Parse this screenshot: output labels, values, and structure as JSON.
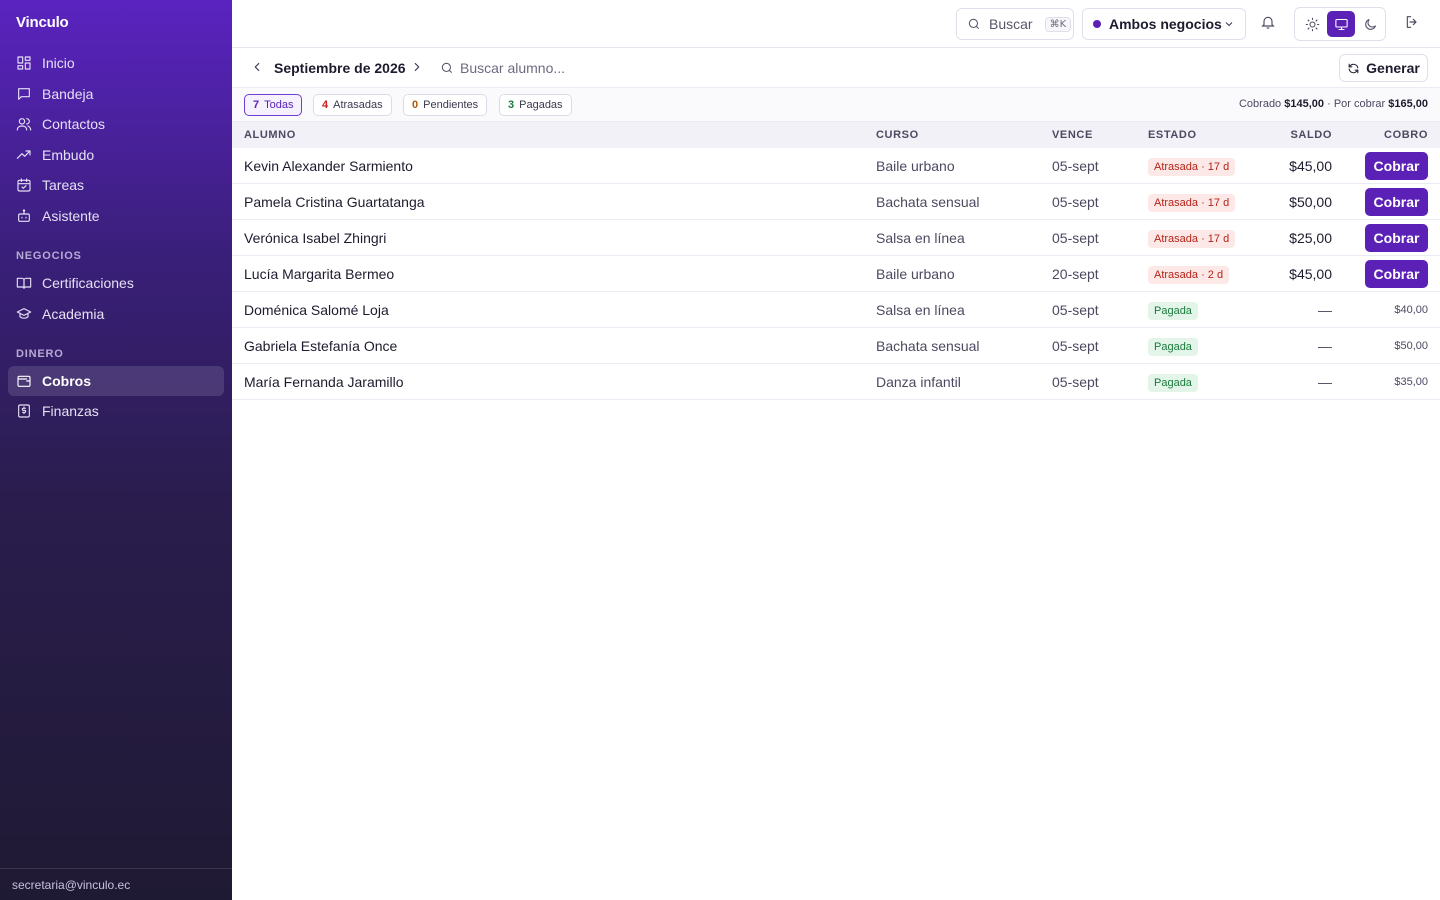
{
  "brand": "Vinculo",
  "sidebar": {
    "main": [
      {
        "label": "Inicio",
        "icon": "grid-icon"
      },
      {
        "label": "Bandeja",
        "icon": "message-icon"
      },
      {
        "label": "Contactos",
        "icon": "users-icon"
      },
      {
        "label": "Embudo",
        "icon": "trending-up-icon"
      },
      {
        "label": "Tareas",
        "icon": "calendar-check-icon"
      },
      {
        "label": "Asistente",
        "icon": "bot-icon"
      }
    ],
    "section_business": "NEGOCIOS",
    "business": [
      {
        "label": "Certificaciones",
        "icon": "book-icon"
      },
      {
        "label": "Academia",
        "icon": "graduation-cap-icon"
      }
    ],
    "section_money": "DINERO",
    "money": [
      {
        "label": "Cobros",
        "icon": "wallet-icon",
        "active": true
      },
      {
        "label": "Finanzas",
        "icon": "receipt-icon"
      }
    ],
    "footer_email": "secretaria@vinculo.ec"
  },
  "topbar": {
    "search_label": "Buscar",
    "search_shortcut": "⌘K",
    "business_select": "Ambos negocios",
    "theme_selected": "system"
  },
  "month": {
    "title": "Septiembre de 2026",
    "search_placeholder": "Buscar alumno...",
    "generate_label": "Generar"
  },
  "filters": [
    {
      "count": "7",
      "label": "Todas",
      "active": true,
      "color": "#5b21b6"
    },
    {
      "count": "4",
      "label": "Atrasadas",
      "color": "#c81e1e"
    },
    {
      "count": "0",
      "label": "Pendientes",
      "color": "#b45309"
    },
    {
      "count": "3",
      "label": "Pagadas",
      "color": "#1a7a3d"
    }
  ],
  "summary": {
    "collected_label": "Cobrado",
    "collected": "$145,00",
    "separator": "·",
    "pending_label": "Por cobrar",
    "pending": "$165,00"
  },
  "table": {
    "headers": [
      "ALUMNO",
      "CURSO",
      "VENCE",
      "ESTADO",
      "SALDO",
      "COBRO"
    ],
    "rows": [
      {
        "name": "Kevin Alexander Sarmiento",
        "course": "Baile urbano",
        "due": "05-sept",
        "status": "Atrasada · 17 d",
        "status_type": "late",
        "balance": "$45,00",
        "action": "Cobrar"
      },
      {
        "name": "Pamela Cristina Guartatanga",
        "course": "Bachata sensual",
        "due": "05-sept",
        "status": "Atrasada · 17 d",
        "status_type": "late",
        "balance": "$50,00",
        "action": "Cobrar"
      },
      {
        "name": "Verónica Isabel Zhingri",
        "course": "Salsa en línea",
        "due": "05-sept",
        "status": "Atrasada · 17 d",
        "status_type": "late",
        "balance": "$25,00",
        "action": "Cobrar"
      },
      {
        "name": "Lucía Margarita Bermeo",
        "course": "Baile urbano",
        "due": "20-sept",
        "status": "Atrasada · 2 d",
        "status_type": "late",
        "balance": "$45,00",
        "action": "Cobrar"
      },
      {
        "name": "Doménica Salomé Loja",
        "course": "Salsa en línea",
        "due": "05-sept",
        "status": "Pagada",
        "status_type": "paid",
        "balance": "—",
        "paid_amount": "$40,00"
      },
      {
        "name": "Gabriela Estefanía Once",
        "course": "Bachata sensual",
        "due": "05-sept",
        "status": "Pagada",
        "status_type": "paid",
        "balance": "—",
        "paid_amount": "$50,00"
      },
      {
        "name": "María Fernanda Jaramillo",
        "course": "Danza infantil",
        "due": "05-sept",
        "status": "Pagada",
        "status_type": "paid",
        "balance": "—",
        "paid_amount": "$35,00"
      }
    ]
  }
}
